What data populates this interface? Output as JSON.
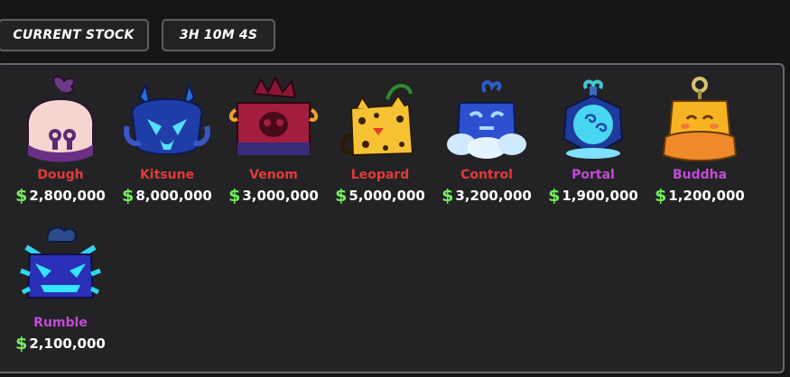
{
  "tabs": {
    "stock_label": "CURRENT STOCK",
    "timer_label": "3H 10M 4S"
  },
  "colors": {
    "mythical": "#e23b3b",
    "legendary": "#c24bd8",
    "price_symbol": "#73ee5c"
  },
  "currency_symbol": "$",
  "fruits": [
    {
      "name": "Dough",
      "price": "2,800,000",
      "rarity_color": "#e23b3b",
      "icon": "dough-fruit-icon"
    },
    {
      "name": "Kitsune",
      "price": "8,000,000",
      "rarity_color": "#e23b3b",
      "icon": "kitsune-fruit-icon"
    },
    {
      "name": "Venom",
      "price": "3,000,000",
      "rarity_color": "#e23b3b",
      "icon": "venom-fruit-icon"
    },
    {
      "name": "Leopard",
      "price": "5,000,000",
      "rarity_color": "#e23b3b",
      "icon": "leopard-fruit-icon"
    },
    {
      "name": "Control",
      "price": "3,200,000",
      "rarity_color": "#e23b3b",
      "icon": "control-fruit-icon"
    },
    {
      "name": "Portal",
      "price": "1,900,000",
      "rarity_color": "#c24bd8",
      "icon": "portal-fruit-icon"
    },
    {
      "name": "Buddha",
      "price": "1,200,000",
      "rarity_color": "#c24bd8",
      "icon": "buddha-fruit-icon"
    },
    {
      "name": "Rumble",
      "price": "2,100,000",
      "rarity_color": "#c24bd8",
      "icon": "rumble-fruit-icon"
    }
  ]
}
